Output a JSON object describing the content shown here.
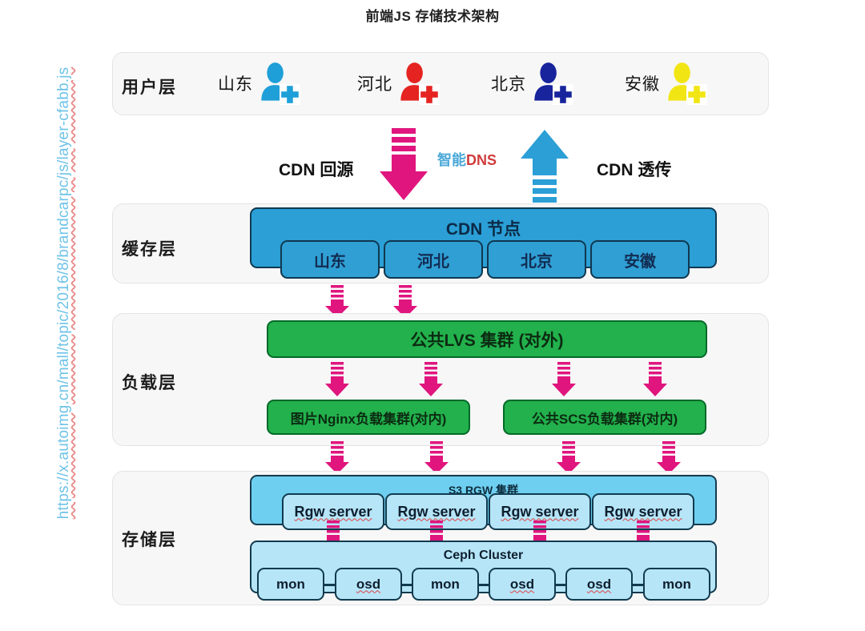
{
  "title": "前端JS 存储技术架构",
  "watermark": "https://x.autoimg.cn/mall/topic/2016/8/brandcarpc/js/layer-cfabb.js",
  "colors": {
    "pink_arrow": "#e0157e",
    "blue_arrow": "#2b9fd6",
    "cdn_blue": "#2b9fd6",
    "lvs_green": "#22b14c",
    "rgw_cyan": "#6ecff0",
    "sub_cyan": "#b6e5f8",
    "panel_bg": "#f7f7f7",
    "dns_cn": "#4aa8d8",
    "dns_en": "#d13b3b",
    "watermark": "#6fc3e8"
  },
  "user_layer": {
    "label": "用户层",
    "items": [
      {
        "name": "山东",
        "icon": "user-add-icon",
        "color": "#1f9fd8"
      },
      {
        "name": "河北",
        "icon": "user-add-icon",
        "color": "#e52421"
      },
      {
        "name": "北京",
        "icon": "user-add-icon",
        "color": "#18249c"
      },
      {
        "name": "安徽",
        "icon": "user-add-icon",
        "color": "#f2e514"
      }
    ]
  },
  "flow": {
    "left_label": "CDN 回源",
    "dns_cn": "智能",
    "dns_en": "DNS",
    "right_label": "CDN 透传",
    "down_arrow_icon": "down-arrow-icon",
    "up_arrow_icon": "up-arrow-icon"
  },
  "cache_layer": {
    "label": "缓存层",
    "main_box": "CDN 节点",
    "nodes": [
      "山东",
      "河北",
      "北京",
      "安徽"
    ]
  },
  "load_layer": {
    "label": "负载层",
    "main_box": "公共LVS 集群 (对外)",
    "sub_boxes": [
      "图片Nginx负载集群(对内)",
      "公共SCS负载集群(对内)"
    ]
  },
  "storage_layer": {
    "label": "存储层",
    "rgw_group": "S3 RGW 集群",
    "rgw_servers": [
      "Rgw server",
      "Rgw server",
      "Rgw server",
      "Rgw server"
    ],
    "ceph_group": "Ceph Cluster",
    "ceph_nodes": [
      "mon",
      "osd",
      "mon",
      "osd",
      "osd",
      "mon"
    ]
  }
}
